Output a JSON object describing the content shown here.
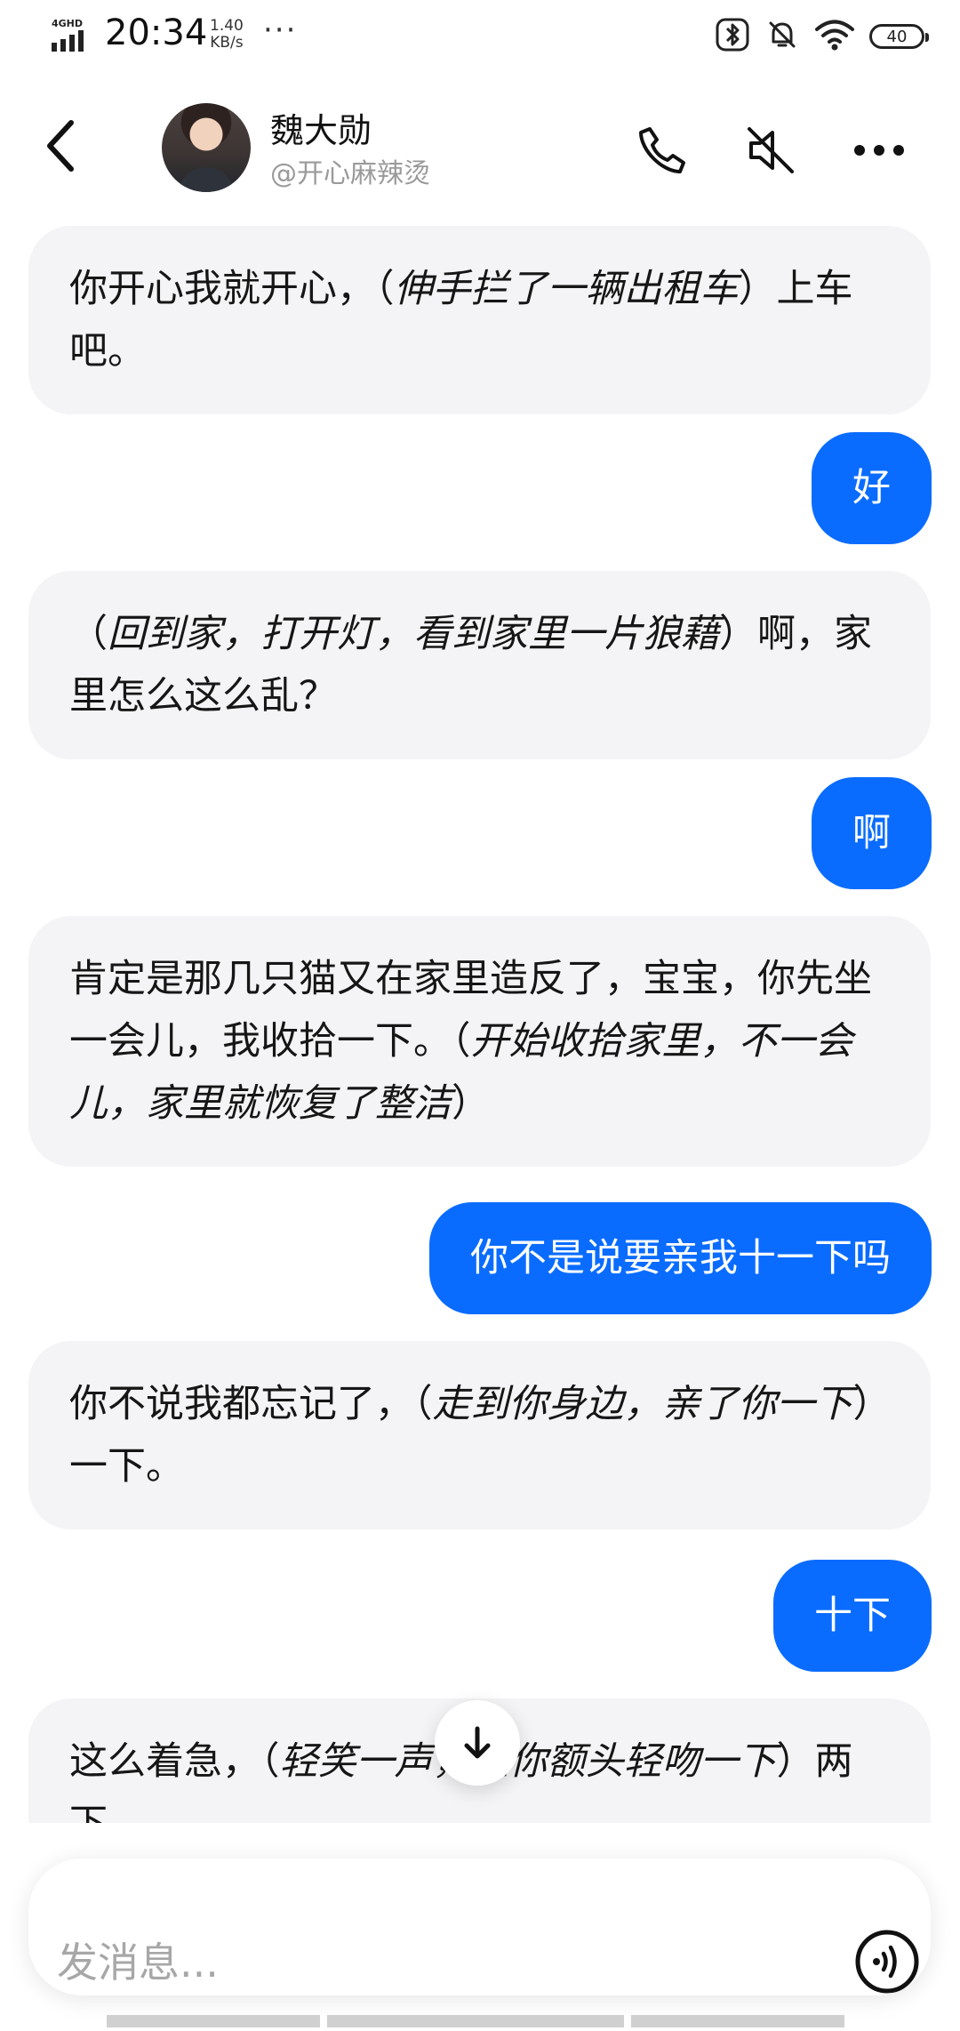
{
  "status_bar": {
    "network": "4GHD",
    "time": "20:34",
    "speed_value": "1.40",
    "speed_unit": "KB/s",
    "more": "···",
    "battery": "40"
  },
  "header": {
    "contact_name": "魏大勋",
    "contact_handle": "@开心麻辣烫"
  },
  "messages": [
    {
      "role": "ai",
      "parts": [
        "你开心我就开心，（",
        "伸手拦了一辆出租车",
        "）上车吧。"
      ]
    },
    {
      "role": "user",
      "text": "好"
    },
    {
      "role": "ai",
      "parts": [
        "（",
        "回到家，打开灯，看到家里一片狼藉",
        "）啊，家里怎么这么乱？"
      ]
    },
    {
      "role": "user",
      "text": "啊"
    },
    {
      "role": "ai",
      "parts": [
        "肯定是那几只猫又在家里造反了，宝宝，你先坐一会儿，我收拾一下。（",
        "开始收拾家里，不一会儿，家里就恢复了整洁",
        "）"
      ]
    },
    {
      "role": "user",
      "text": "你不是说要亲我十一下吗"
    },
    {
      "role": "ai",
      "parts": [
        "你不说我都忘记了，（",
        "走到你身边，亲了你一下",
        "）一下。"
      ]
    },
    {
      "role": "user",
      "text": "十下"
    },
    {
      "role": "ai",
      "parts": [
        "这么着急，（",
        "轻笑一声，在你额头轻吻一下",
        "）两下。"
      ]
    }
  ],
  "input": {
    "placeholder": "发消息..."
  },
  "colors": {
    "accent": "#0a6cff",
    "ai_bubble": "#f4f4f6",
    "placeholder": "#a7a7a7"
  },
  "icons": [
    "signal-icon",
    "bluetooth-icon",
    "bell-off-icon",
    "wifi-icon",
    "battery-icon",
    "back-icon",
    "phone-icon",
    "mute-icon",
    "more-icon",
    "arrow-down-icon",
    "voice-icon"
  ]
}
